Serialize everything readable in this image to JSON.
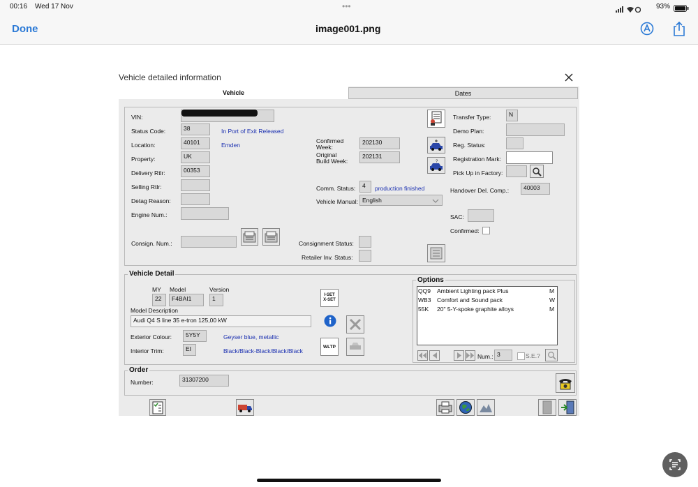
{
  "status_bar": {
    "time": "00:16",
    "date": "Wed 17 Nov",
    "battery": "93%",
    "dots": "•••"
  },
  "header": {
    "done": "Done",
    "filename": "image001.png",
    "icons": [
      "markup-icon",
      "share-icon"
    ]
  },
  "dialog": {
    "title": "Vehicle detailed information",
    "tabs": [
      "Vehicle",
      "Dates"
    ],
    "vehicle": {
      "vin_label": "VIN:",
      "vin_value": "",
      "status_label": "Status Code:",
      "status_code": "38",
      "status_text": "In Port of Exit Released",
      "location_label": "Location:",
      "location_code": "40101",
      "location_text": "Emden",
      "property_label": "Property:",
      "property_value": "UK",
      "delivery_label": "Delivery Rtlr:",
      "delivery_value": "00353",
      "selling_label": "Selling Rtlr:",
      "selling_value": "",
      "detag_label": "Detag Reason:",
      "detag_value": "",
      "engine_label": "Engine Num.:",
      "engine_value": "",
      "consign_num_label": "Consign. Num.:",
      "consign_num_value": "",
      "confirmed_week_label": "Confirmed\nWeek:",
      "confirmed_week_value": "202130",
      "original_week_label": "Original\nBuild Week:",
      "original_week_value": "202131",
      "comm_status_label": "Comm. Status:",
      "comm_status_code": "4",
      "comm_status_text": "production finished",
      "manual_label": "Vehicle Manual:",
      "manual_value": "English",
      "consign_status_label": "Consignment Status:",
      "retailer_inv_label": "Retailer Inv. Status:",
      "transfer_label": "Transfer Type:",
      "transfer_value": "N",
      "demo_label": "Demo Plan:",
      "reg_status_label": "Reg. Status:",
      "reg_mark_label": "Registration Mark:",
      "pickup_label": "Pick Up in Factory:",
      "handover_label": "Handover Del. Comp.:",
      "handover_value": "40003",
      "sac_label": "SAC:",
      "confirmed_label": "Confirmed:"
    },
    "vehicle_detail": {
      "legend": "Vehicle Detail",
      "my_label": "MY",
      "my_value": "22",
      "model_label": "Model",
      "model_value": "F4BAI1",
      "version_label": "Version",
      "version_value": "1",
      "desc_label": "Model Description",
      "desc_value": "Audi Q4  S line 35 e-tron  125,00 kW",
      "ext_label": "Exterior Colour:",
      "ext_code": "5Y5Y",
      "ext_text": "Geyser blue, metallic",
      "int_label": "Interior Trim:",
      "int_code": "EI",
      "int_text": "Black/Black-Black/Black/Black",
      "iset_label": "I-SET\nX-SET",
      "wltp_label": "WLTP"
    },
    "options": {
      "legend": "Options",
      "items": [
        {
          "code": "QQ9",
          "desc": "Ambient Lighting pack Plus",
          "flag": "M"
        },
        {
          "code": "WB3",
          "desc": "Comfort and Sound pack",
          "flag": "W"
        },
        {
          "code": "55K",
          "desc": "20\" 5-Y-spoke graphite alloys",
          "flag": "M"
        }
      ],
      "num_label": "Num.:",
      "num_value": "3",
      "se_label": "S.E.?"
    },
    "order": {
      "legend": "Order",
      "number_label": "Number:",
      "number_value": "31307200"
    }
  }
}
